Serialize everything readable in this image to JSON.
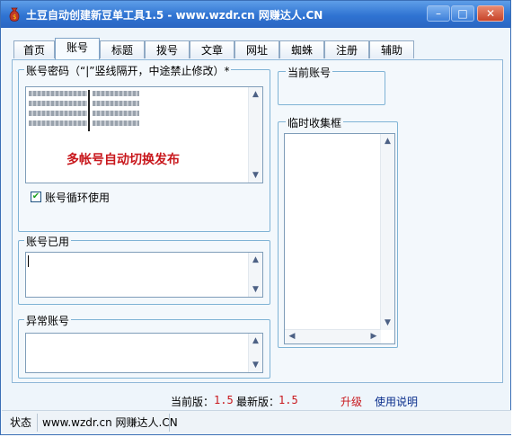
{
  "window": {
    "title": "土豆自动创建新豆单工具1.5 - www.wzdr.cn 网赚达人.CN",
    "controls": {
      "minimize": "–",
      "maximize": "□",
      "close": "✕"
    }
  },
  "tabs": [
    "首页",
    "账号",
    "标题",
    "拨号",
    "文章",
    "网址",
    "蜘蛛",
    "注册",
    "辅助"
  ],
  "active_tab": "账号",
  "account_group": {
    "label": "账号密码（“|”竖线隔开，中途禁止修改）*",
    "overlay_text": "多帐号自动切换发布",
    "loop_checkbox": {
      "label": "账号循环使用",
      "checked": true
    }
  },
  "used_group": {
    "label": "账号已用"
  },
  "abnormal_group": {
    "label": "异常账号"
  },
  "current_group": {
    "label": "当前账号"
  },
  "collect_group": {
    "label": "临时收集框"
  },
  "version": {
    "current_label": "当前版：",
    "current_value": "1.5",
    "latest_label": "最新版：",
    "latest_value": "1.5",
    "upgrade": "升级",
    "manual": "使用说明"
  },
  "statusbar": {
    "label": "状态",
    "site": "www.wzdr.cn 网赚达人.CN"
  },
  "colors": {
    "titlebar": "#2f73d2",
    "red": "#c8171c",
    "link": "#0a2e8c",
    "accent_border": "#7fb3d5"
  }
}
